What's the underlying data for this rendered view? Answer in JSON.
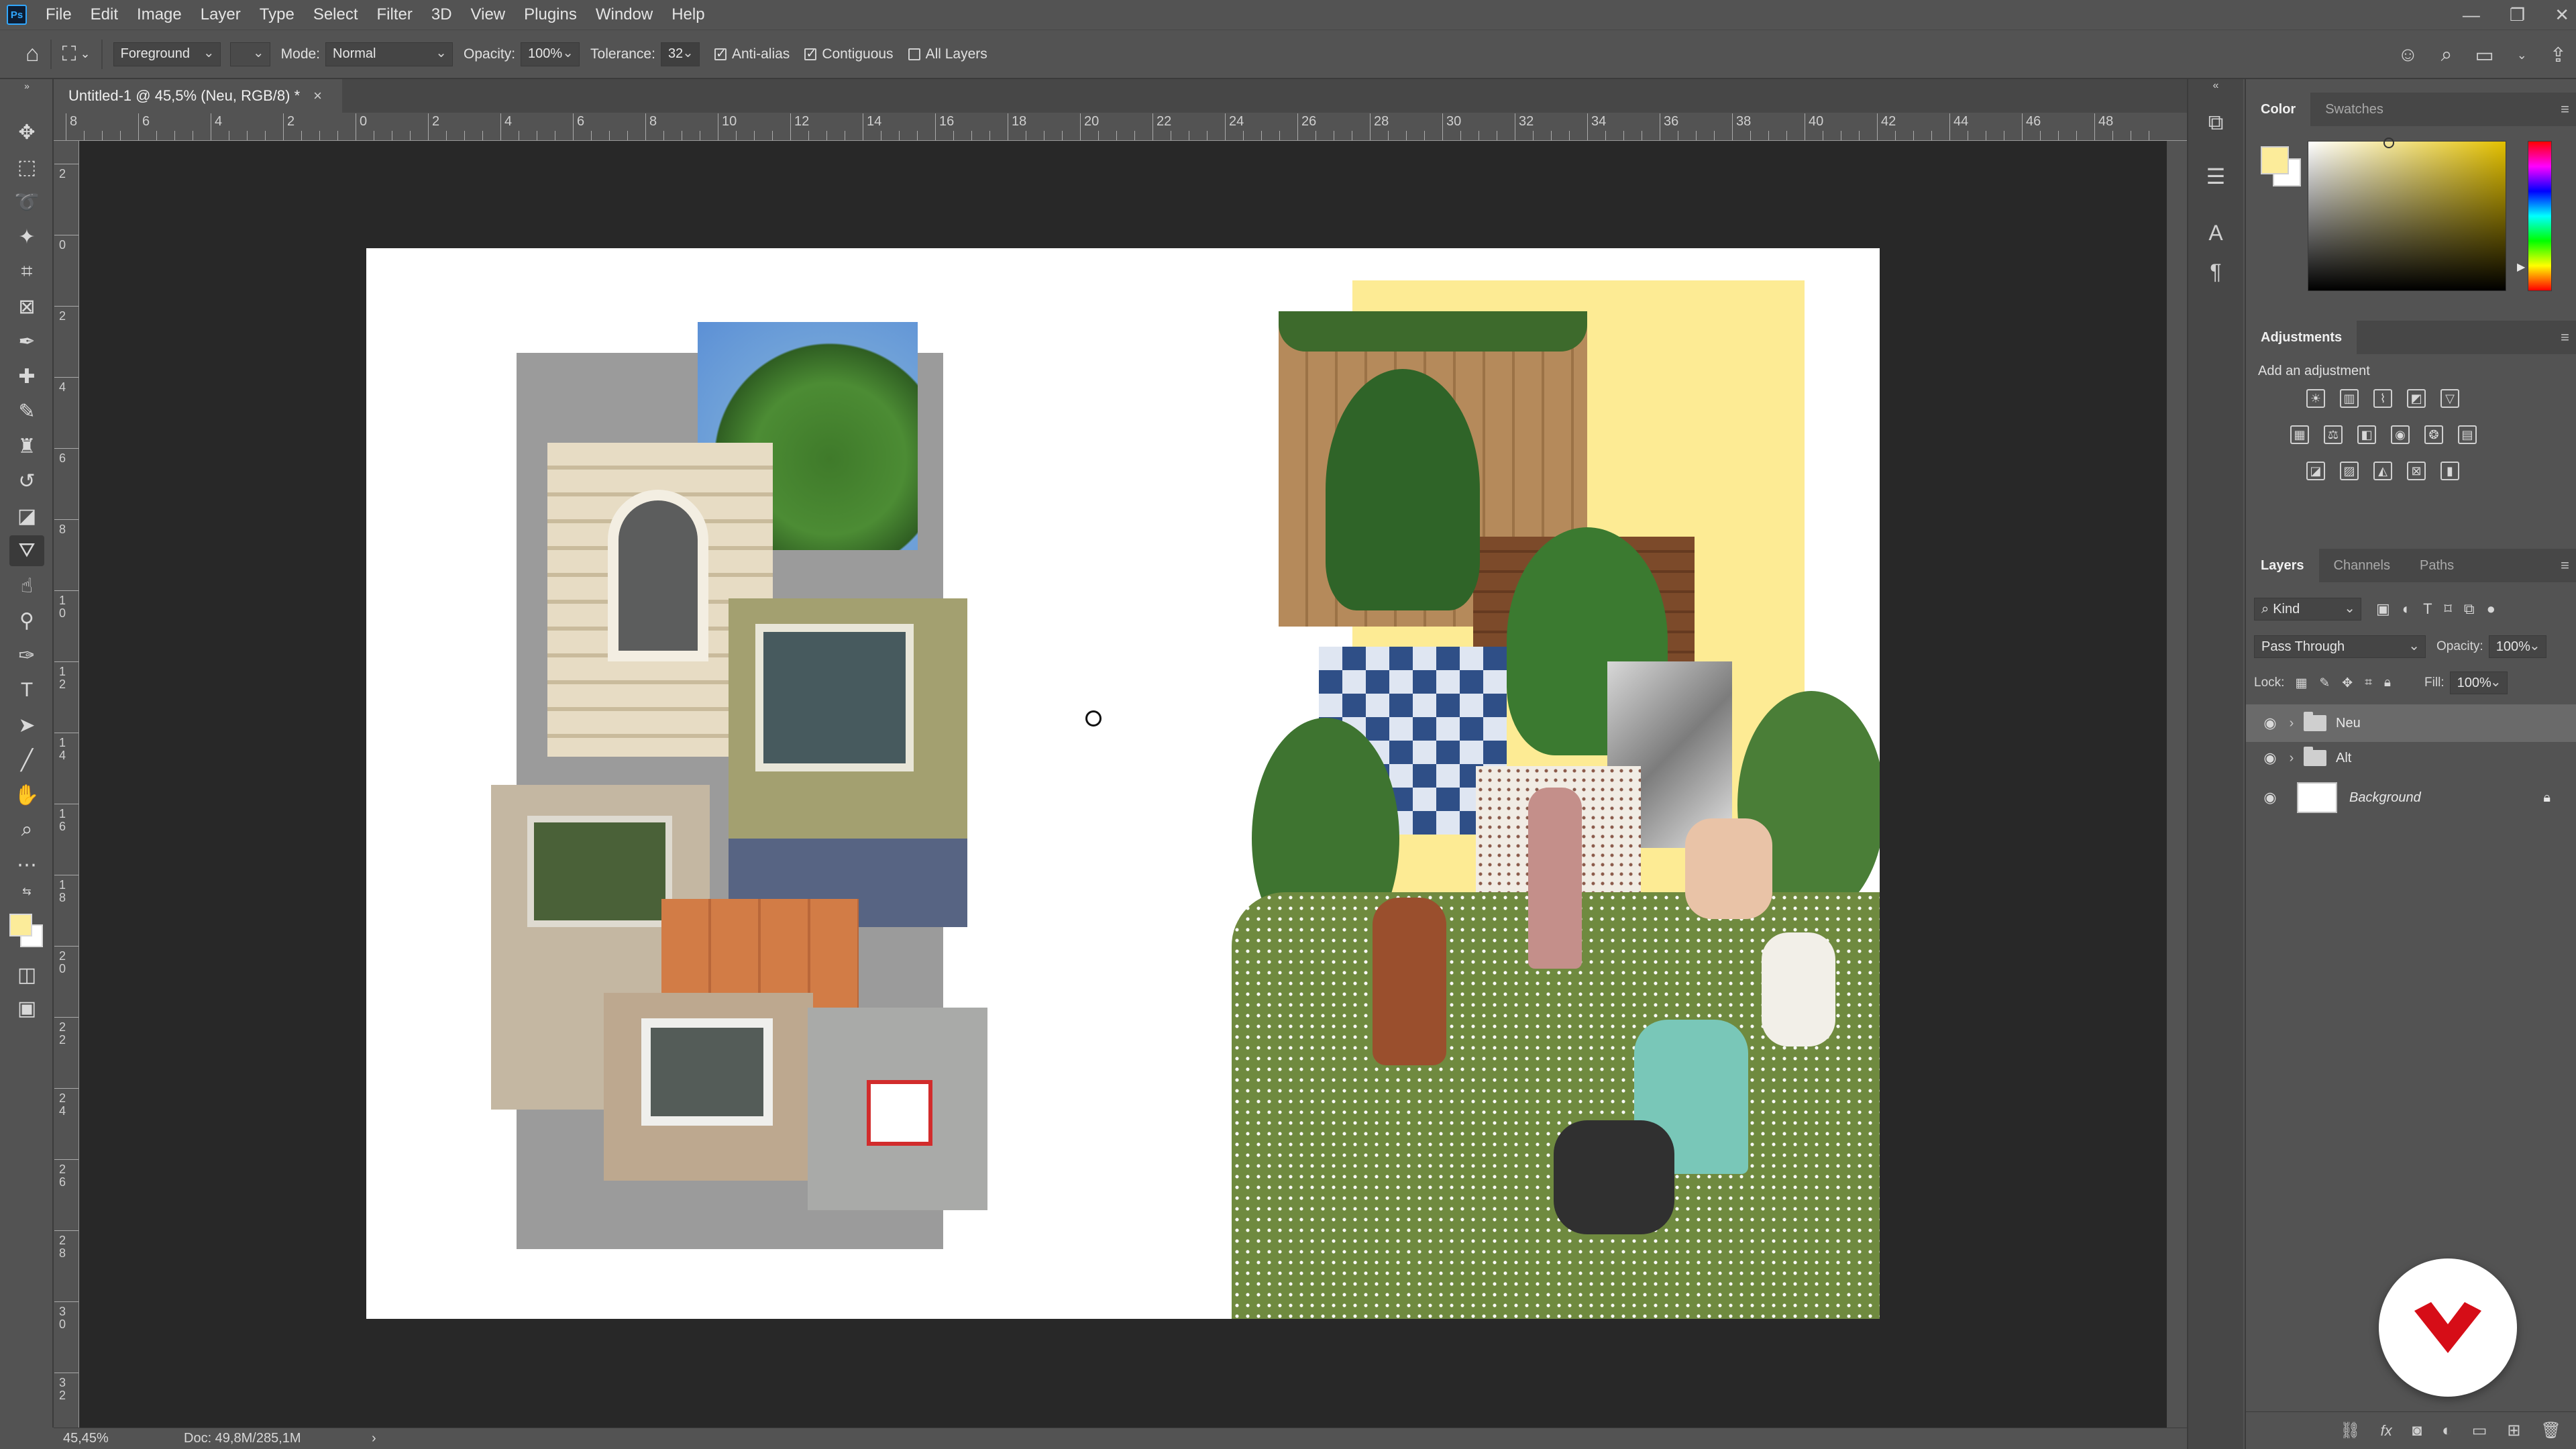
{
  "menubar": {
    "logo": "Ps",
    "items": [
      "File",
      "Edit",
      "Image",
      "Layer",
      "Type",
      "Select",
      "Filter",
      "3D",
      "View",
      "Plugins",
      "Window",
      "Help"
    ],
    "window_controls": [
      "—",
      "❐",
      "✕"
    ]
  },
  "options": {
    "fill_source": "Foreground",
    "mode_label": "Mode:",
    "mode_value": "Normal",
    "opacity_label": "Opacity:",
    "opacity_value": "100%",
    "tolerance_label": "Tolerance:",
    "tolerance_value": "32",
    "anti_alias": {
      "label": "Anti-alias",
      "checked": true
    },
    "contiguous": {
      "label": "Contiguous",
      "checked": true
    },
    "all_layers": {
      "label": "All Layers",
      "checked": false
    }
  },
  "document": {
    "tab_title": "Untitled-1 @ 45,5% (Neu, RGB/8) *",
    "close": "×"
  },
  "ruler": {
    "top_labels": [
      "8",
      "6",
      "4",
      "2",
      "0",
      "2",
      "4",
      "6",
      "8",
      "10",
      "12",
      "14",
      "16",
      "18",
      "20",
      "22",
      "24",
      "26",
      "28",
      "30",
      "32",
      "34",
      "36",
      "38",
      "40",
      "42",
      "44",
      "46",
      "48"
    ],
    "left_labels": [
      "2",
      "0",
      "2",
      "4",
      "6",
      "8",
      "10",
      "12",
      "14",
      "16",
      "18",
      "20",
      "22",
      "24",
      "26",
      "28",
      "30",
      "32"
    ]
  },
  "status": {
    "zoom": "45,45%",
    "doc_size": "Doc: 49,8M/285,1M",
    "arrow": "›"
  },
  "color_panel": {
    "tabs": [
      "Color",
      "Swatches"
    ],
    "foreground": "#fcec9a",
    "background": "#ffffff"
  },
  "adjustments_panel": {
    "tabs": [
      "Adjustments"
    ],
    "hint": "Add an adjustment"
  },
  "layers_panel": {
    "tabs": [
      "Layers",
      "Channels",
      "Paths"
    ],
    "filter_kind": "Kind",
    "blend_mode": "Pass Through",
    "opacity_label": "Opacity:",
    "opacity_value": "100%",
    "lock_label": "Lock:",
    "fill_label": "Fill:",
    "fill_value": "100%",
    "layers": [
      {
        "name": "Neu",
        "type": "group",
        "visible": true,
        "selected": true
      },
      {
        "name": "Alt",
        "type": "group",
        "visible": true,
        "selected": false
      },
      {
        "name": "Background",
        "type": "pixel",
        "visible": true,
        "selected": false,
        "locked": true
      }
    ]
  },
  "colors": {
    "ui_bg": "#535353",
    "canvas_bg": "#282828",
    "accent": "#31a8ff",
    "collage_yellow": "#fdeb94",
    "collage_gray": "#9b9b9b",
    "watermark_red": "#d60d17"
  }
}
